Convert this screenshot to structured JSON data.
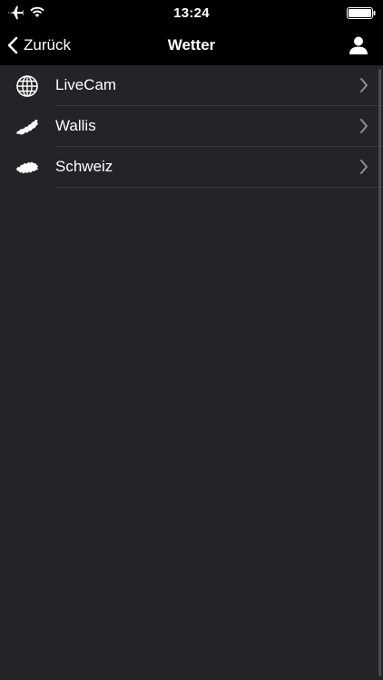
{
  "status_bar": {
    "time": "13:24",
    "icons": [
      "airplane-icon",
      "wifi-icon",
      "battery-icon"
    ]
  },
  "nav": {
    "back_label": "Zurück",
    "title": "Wetter",
    "right_icon": "person-icon"
  },
  "list": {
    "items": [
      {
        "label": "LiveCam",
        "icon": "globe-icon"
      },
      {
        "label": "Wallis",
        "icon": "wallis-map-icon"
      },
      {
        "label": "Schweiz",
        "icon": "switzerland-map-icon"
      }
    ]
  },
  "colors": {
    "background": "#242428",
    "bars": "#000000",
    "text": "#ffffff",
    "divider": "#3a3a3e",
    "chevron": "#8e8e93"
  }
}
